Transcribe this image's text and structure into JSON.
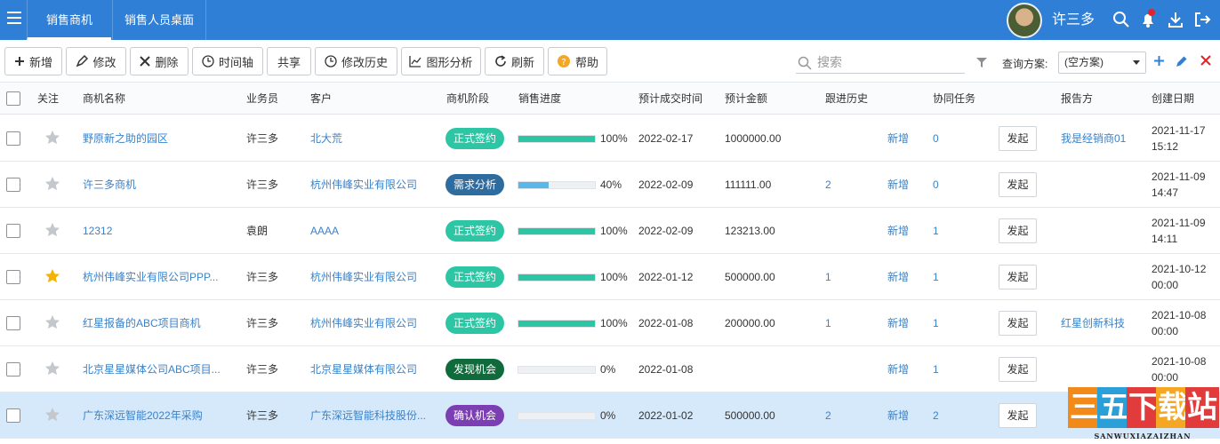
{
  "topbar": {
    "tabs": [
      {
        "label": "销售商机",
        "active": true
      },
      {
        "label": "销售人员桌面",
        "active": false
      }
    ],
    "username": "许三多",
    "bg_color": "#2f7fd6"
  },
  "toolbar": {
    "buttons": [
      {
        "label": "新增",
        "icon": "plus-icon"
      },
      {
        "label": "修改",
        "icon": "pencil-icon"
      },
      {
        "label": "删除",
        "icon": "close-icon"
      },
      {
        "label": "时间轴",
        "icon": "clock-icon"
      },
      {
        "label": "共享",
        "icon": ""
      },
      {
        "label": "修改历史",
        "icon": "clock-icon"
      },
      {
        "label": "图形分析",
        "icon": "chart-icon"
      },
      {
        "label": "刷新",
        "icon": "refresh-icon"
      },
      {
        "label": "帮助",
        "icon": "help-icon"
      }
    ],
    "search_placeholder": "搜索",
    "query_label": "查询方案:",
    "query_value": "(空方案)"
  },
  "table": {
    "headers": [
      "关注",
      "商机名称",
      "业务员",
      "客户",
      "商机阶段",
      "销售进度",
      "预计成交时间",
      "预计金额",
      "跟进历史",
      "协同任务",
      "报告方",
      "创建日期"
    ],
    "stage_colors": {
      "正式签约": "#2dc6a4",
      "需求分析": "#2e6b9e",
      "发现机会": "#0f6b3c",
      "确认机会": "#7b3fb3"
    },
    "action_label": "发起",
    "rows": [
      {
        "starred": false,
        "name": "野原新之助的园区",
        "salesperson": "许三多",
        "customer": "北大荒",
        "stage": "正式签约",
        "stage_color": "#2dc6a4",
        "progress": 100,
        "progress_text": "100%",
        "deal_date": "2022-02-17",
        "amount": "1000000.00",
        "history": "",
        "new_label": "新增",
        "tasks": "0",
        "reporter": "我是经销商01",
        "created": "2021-11-17\n15:12",
        "selected": false
      },
      {
        "starred": false,
        "name": "许三多商机",
        "salesperson": "许三多",
        "customer": "杭州伟峰实业有限公司",
        "stage": "需求分析",
        "stage_color": "#2e6b9e",
        "progress": 40,
        "progress_text": "40%",
        "deal_date": "2022-02-09",
        "amount": "111111.00",
        "history": "2",
        "new_label": "新增",
        "tasks": "0",
        "reporter": "",
        "created": "2021-11-09\n14:47",
        "selected": false
      },
      {
        "starred": false,
        "name": "12312",
        "salesperson": "袁朗",
        "customer": "AAAA",
        "stage": "正式签约",
        "stage_color": "#2dc6a4",
        "progress": 100,
        "progress_text": "100%",
        "deal_date": "2022-02-09",
        "amount": "123213.00",
        "history": "",
        "new_label": "新增",
        "tasks": "1",
        "reporter": "",
        "created": "2021-11-09\n14:11",
        "selected": false
      },
      {
        "starred": true,
        "name": "杭州伟峰实业有限公司PPP...",
        "salesperson": "许三多",
        "customer": "杭州伟峰实业有限公司",
        "stage": "正式签约",
        "stage_color": "#2dc6a4",
        "progress": 100,
        "progress_text": "100%",
        "deal_date": "2022-01-12",
        "amount": "500000.00",
        "history": "1",
        "new_label": "新增",
        "tasks": "1",
        "reporter": "",
        "created": "2021-10-12\n00:00",
        "selected": false
      },
      {
        "starred": false,
        "name": "红星报备的ABC项目商机",
        "salesperson": "许三多",
        "customer": "杭州伟峰实业有限公司",
        "stage": "正式签约",
        "stage_color": "#2dc6a4",
        "progress": 100,
        "progress_text": "100%",
        "deal_date": "2022-01-08",
        "amount": "200000.00",
        "history": "1",
        "new_label": "新增",
        "tasks": "1",
        "reporter": "红星创新科技",
        "created": "2021-10-08\n00:00",
        "selected": false
      },
      {
        "starred": false,
        "name": "北京星星媒体公司ABC项目...",
        "salesperson": "许三多",
        "customer": "北京星星媒体有限公司",
        "stage": "发现机会",
        "stage_color": "#0f6b3c",
        "progress": 0,
        "progress_text": "0%",
        "deal_date": "2022-01-08",
        "amount": "",
        "history": "",
        "new_label": "新增",
        "tasks": "1",
        "reporter": "",
        "created": "2021-10-08\n00:00",
        "selected": false
      },
      {
        "starred": false,
        "name": "广东深远智能2022年采购",
        "salesperson": "许三多",
        "customer": "广东深远智能科技股份...",
        "stage": "确认机会",
        "stage_color": "#7b3fb3",
        "progress": 0,
        "progress_text": "0%",
        "deal_date": "2022-01-02",
        "amount": "500000.00",
        "history": "2",
        "new_label": "新增",
        "tasks": "2",
        "reporter": "",
        "created": "",
        "selected": true
      }
    ]
  },
  "watermark": {
    "chars": [
      "三",
      "五",
      "下",
      "载",
      "站"
    ],
    "colors": [
      "#f28a1a",
      "#2b9fd8",
      "#e23b3b",
      "#f5a623",
      "#e23b3b"
    ],
    "sub": "SANWUXIAZAIZHAN"
  }
}
